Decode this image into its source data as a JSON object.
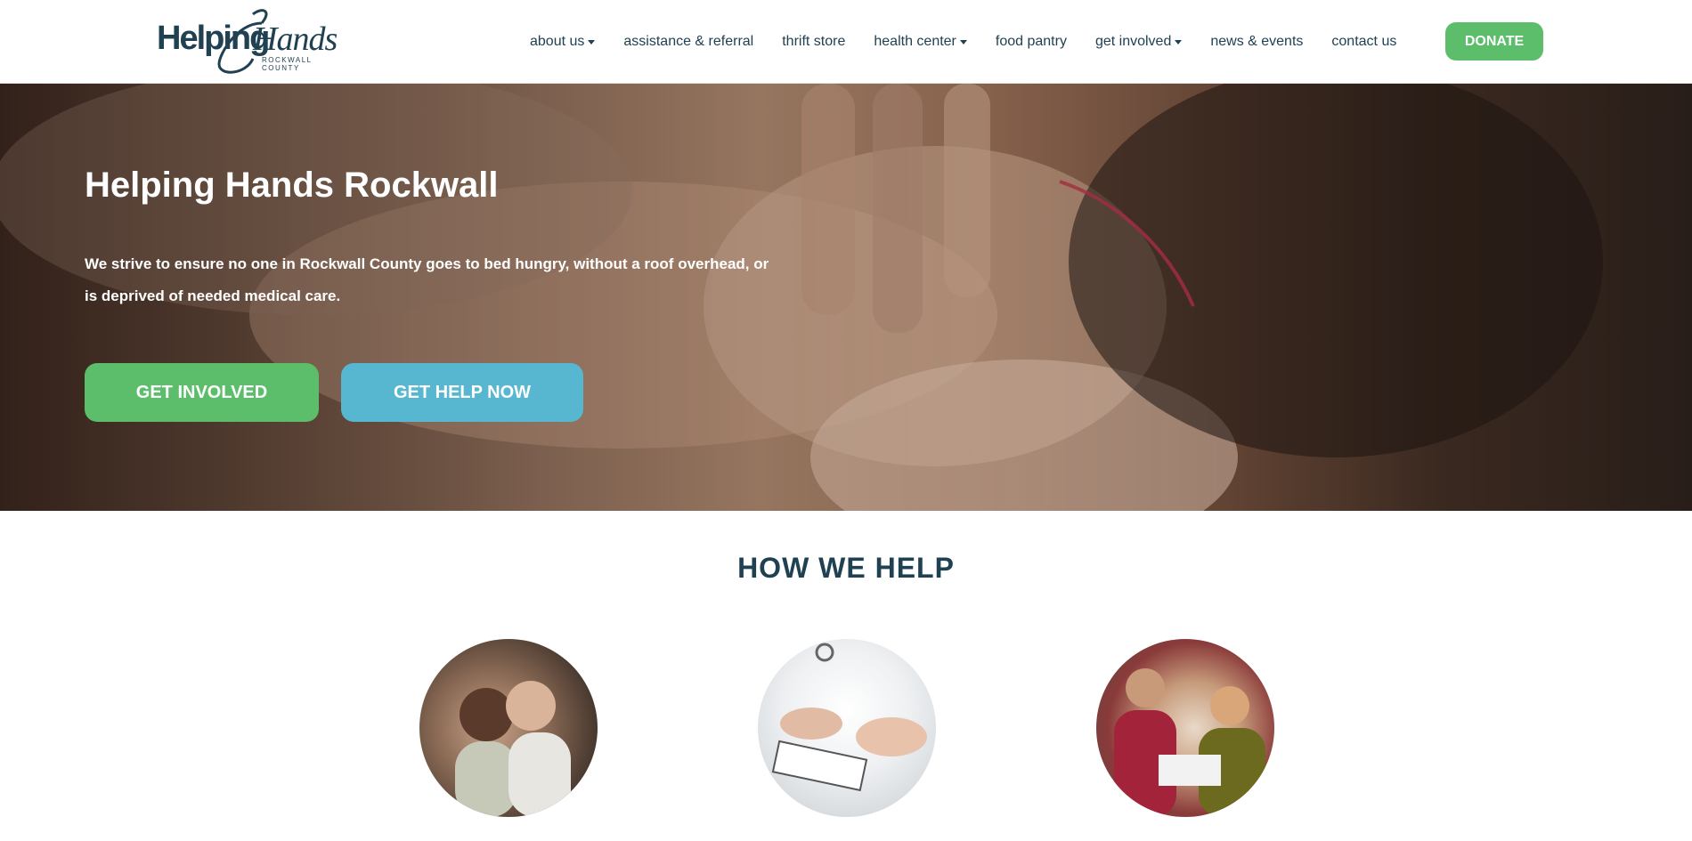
{
  "logo": {
    "word1": "Helping",
    "word2": "Hands",
    "subtitle": "ROCKWALL COUNTY"
  },
  "nav": {
    "items": [
      {
        "label": "about us",
        "dropdown": true
      },
      {
        "label": "assistance & referral",
        "dropdown": false
      },
      {
        "label": "thrift store",
        "dropdown": false
      },
      {
        "label": "health center",
        "dropdown": true
      },
      {
        "label": "food pantry",
        "dropdown": false
      },
      {
        "label": "get involved",
        "dropdown": true
      },
      {
        "label": "news & events",
        "dropdown": false
      },
      {
        "label": "contact us",
        "dropdown": false
      }
    ],
    "donate_label": "DONATE"
  },
  "hero": {
    "title": "Helping Hands Rockwall",
    "text": "We strive to ensure no one in Rockwall County goes to bed hungry, without a roof overhead, or is deprived of needed medical care.",
    "get_involved_label": "GET INVOLVED",
    "get_help_label": "GET HELP NOW"
  },
  "how_we_help": {
    "title": "HOW WE HELP"
  },
  "colors": {
    "brand_navy": "#1f4152",
    "green": "#5cbd6a",
    "blue": "#57b6d0"
  }
}
